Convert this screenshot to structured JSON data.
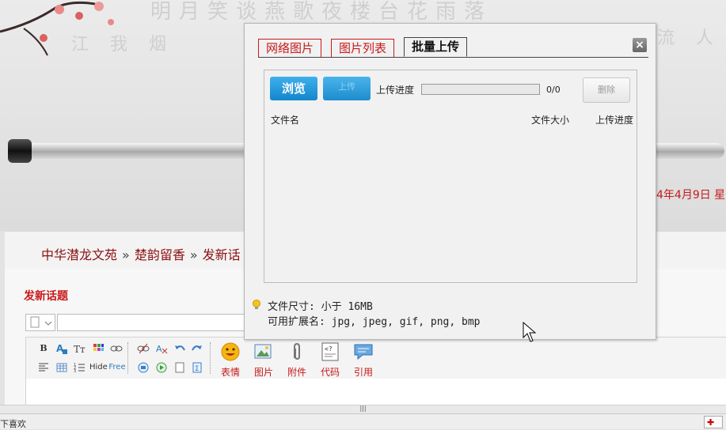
{
  "background": {
    "date_text": "4年4月9日  星"
  },
  "breadcrumb": {
    "items": [
      "中华潜龙文苑",
      "楚韵留香",
      "发新话"
    ],
    "separator": "»"
  },
  "post": {
    "title": "发新话题",
    "toolbar": {
      "small_buttons": [
        "B",
        "Hide",
        "Free"
      ],
      "big_tools": [
        {
          "label": "表情",
          "icon": "smiley-icon"
        },
        {
          "label": "图片",
          "icon": "image-icon"
        },
        {
          "label": "附件",
          "icon": "paperclip-icon"
        },
        {
          "label": "代码",
          "icon": "code-icon"
        },
        {
          "label": "引用",
          "icon": "quote-icon"
        }
      ]
    }
  },
  "resize_handle": "|||",
  "statusbar": {
    "left_text": "下喜欢"
  },
  "dialog": {
    "tabs": [
      "网络图片",
      "图片列表",
      "批量上传"
    ],
    "active_tab": 2,
    "close_label": "×",
    "browse_label": "浏览",
    "upload_label": "上传",
    "progress_label": "上传进度",
    "progress_value": 0,
    "count": "0/0",
    "delete_label": "删除",
    "columns": [
      "文件名",
      "文件大小",
      "上传进度"
    ],
    "info_line1": "文件尺寸: 小于 16MB",
    "info_line2": "可用扩展名: jpg, jpeg, gif, png, bmp"
  },
  "colors": {
    "accent_red": "#c8191a",
    "button_blue": "#1386cc"
  }
}
